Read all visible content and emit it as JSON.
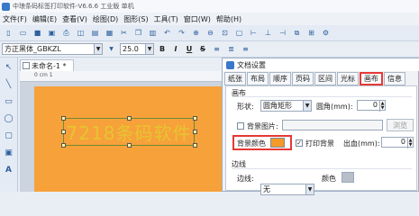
{
  "window": {
    "title": "中琅条码标签打印软件-V6.6.6 工业版 单机"
  },
  "menu": [
    "文件(F)",
    "编辑(E)",
    "查看(V)",
    "绘图(D)",
    "图形(S)",
    "工具(T)",
    "窗口(W)",
    "帮助(H)"
  ],
  "toolbar2": {
    "font": "方正黑体_GBKZL",
    "size": "25.0",
    "bold": "B",
    "italic": "I",
    "underline": "U",
    "strike": "S"
  },
  "document": {
    "tab_label": "未命名-1 *",
    "ruler_unit": "0 cm 1",
    "barcode_text": "7218条码软件"
  },
  "dialog": {
    "title": "文档设置",
    "tabs": [
      "纸张",
      "布局",
      "顺序",
      "页码",
      "区间",
      "光标",
      "画布",
      "信息"
    ],
    "active_tab": "画布",
    "canvas_group": "画布",
    "shape_label": "形状:",
    "shape_value": "圆角矩形",
    "radius_label": "圆角(mm):",
    "radius_value": "0",
    "bg_image_label": "背景图片:",
    "browse_label": "浏览",
    "bg_color_label": "背景颜色",
    "bg_color": "#f39a2a",
    "print_bg_label": "打印背景",
    "bleed_label": "出血(mm):",
    "bleed_value": "0",
    "border_group": "边线",
    "border_label": "边线:",
    "border_value": "无",
    "border_color_label": "颜色"
  }
}
